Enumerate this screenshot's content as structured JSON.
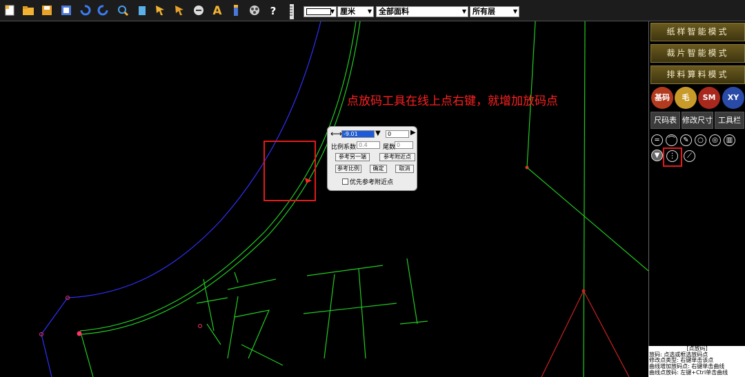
{
  "toolbar": {
    "icons": [
      "new-file-icon",
      "open-folder-icon",
      "save-icon",
      "export-icon",
      "undo-icon",
      "redo-icon",
      "zoom-icon",
      "clear-icon",
      "arrow-select-icon",
      "arrow-adjust-icon",
      "measure-icon",
      "text-icon",
      "figure-icon",
      "palette-icon",
      "help-icon",
      "ruler-icon"
    ],
    "text_icon_glyph": "A",
    "help_glyph": "?",
    "unit": "厘米",
    "material": "全部面料",
    "layer": "所有层"
  },
  "canvas": {
    "annotation": "点放码工具在线上点右键，就增加放码点",
    "text_watermark": "拔开1"
  },
  "dialog": {
    "dx_value": "-9.01",
    "dy_value": "0",
    "ratio_label": "比例系数",
    "ratio_value": "0.4",
    "tail_label": "尾数",
    "tail_value": "0",
    "btn_ref_other_end": "参考另一端",
    "btn_ref_near_point": "参考附近点",
    "btn_ref_ratio": "参考比例",
    "btn_ok": "确定",
    "btn_cancel": "取消",
    "checkbox_label": "优先参考附近点"
  },
  "sidebar": {
    "modes": [
      "纸样智能模式",
      "裁片智能模式",
      "排料算料模式"
    ],
    "circles": [
      {
        "label": "基码",
        "color": "#b23a1e"
      },
      {
        "label": "毛",
        "color": "#c79a2a"
      },
      {
        "label": "SM",
        "color": "#a8281e"
      },
      {
        "label": "XY",
        "color": "#2a4aa8"
      }
    ],
    "buttons": [
      "尺码表",
      "修改尺寸",
      "工具栏"
    ],
    "tool_icons": [
      "line-tool-icon",
      "curve-tool-icon",
      "wrench-tool-icon",
      "circle-tool-icon",
      "target-tool-icon",
      "trash-tool-icon",
      "shirt-tool-icon",
      "point-grade-tool-icon",
      "diagonal-line-tool-icon"
    ]
  },
  "status": {
    "title": "[点放码]",
    "lines": [
      "放码: 点选或框选放码点",
      "修改点类型: 右键单击该点",
      "曲线增加放码点: 右键单击曲线",
      "曲线点放码: 左键+Ctrl单击曲线"
    ]
  },
  "colors": {
    "accent_red": "#e31b1b",
    "pattern_green": "#22cc22",
    "pattern_blue": "#3030ff"
  }
}
